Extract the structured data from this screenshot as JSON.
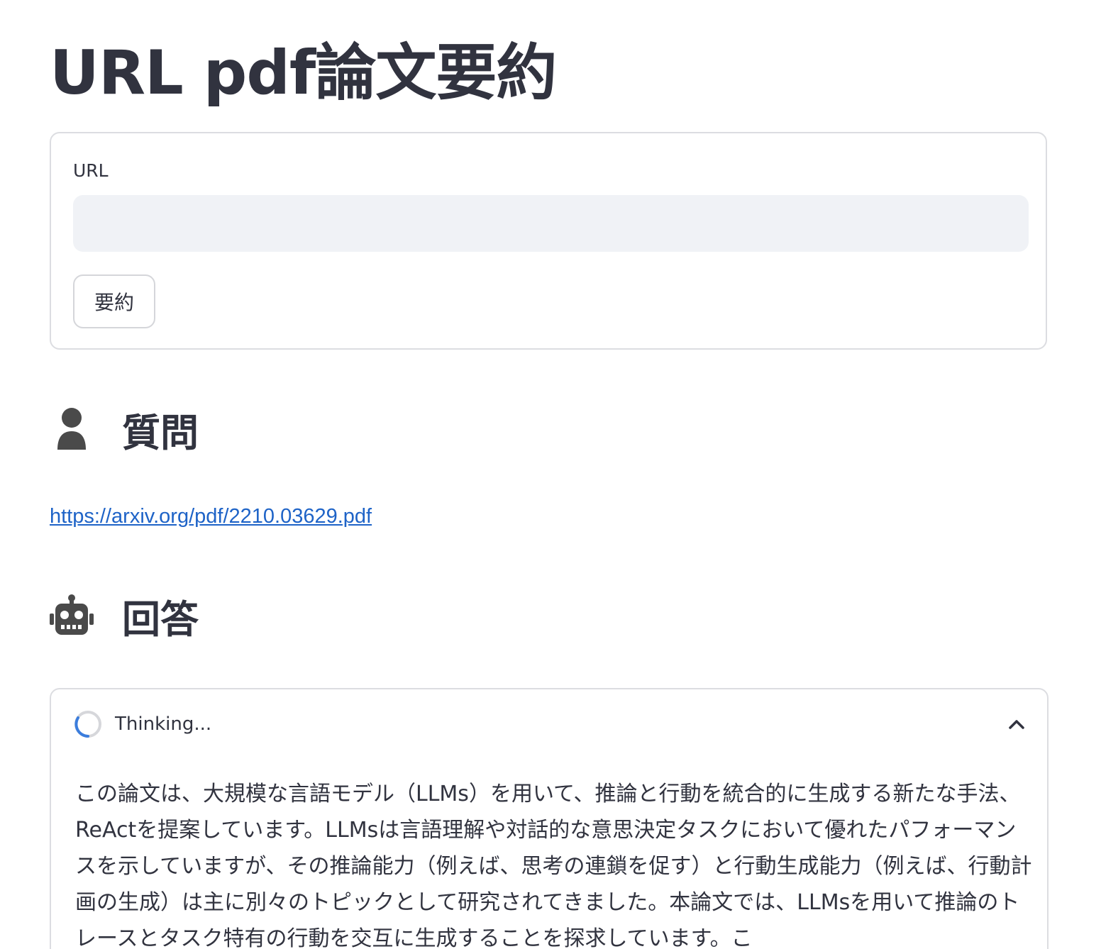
{
  "page": {
    "title": "URL pdf論文要約"
  },
  "form": {
    "url_label": "URL",
    "url_value": "",
    "submit_label": "要約"
  },
  "question": {
    "title": "質問",
    "icon": "user-icon",
    "link": "https://arxiv.org/pdf/2210.03629.pdf"
  },
  "answer": {
    "title": "回答",
    "icon": "robot-icon",
    "status_label": "Thinking...",
    "text": "この論文は、大規模な言語モデル（LLMs）を用いて、推論と行動を統合的に生成する新たな手法、ReActを提案しています。LLMsは言語理解や対話的な意思決定タスクにおいて優れたパフォーマンスを示していますが、その推論能力（例えば、思考の連鎖を促す）と行動生成能力（例えば、行動計画の生成）は主に別々のトピックとして研究されてきました。本論文では、LLMsを用いて推論のトレースとタスク特有の行動を交互に生成することを探求しています。こ"
  },
  "colors": {
    "text": "#31333f",
    "link": "#1e63c7",
    "input_bg": "#f0f2f6",
    "border": "#dcdde1",
    "spinner": "#3b7ddd"
  }
}
